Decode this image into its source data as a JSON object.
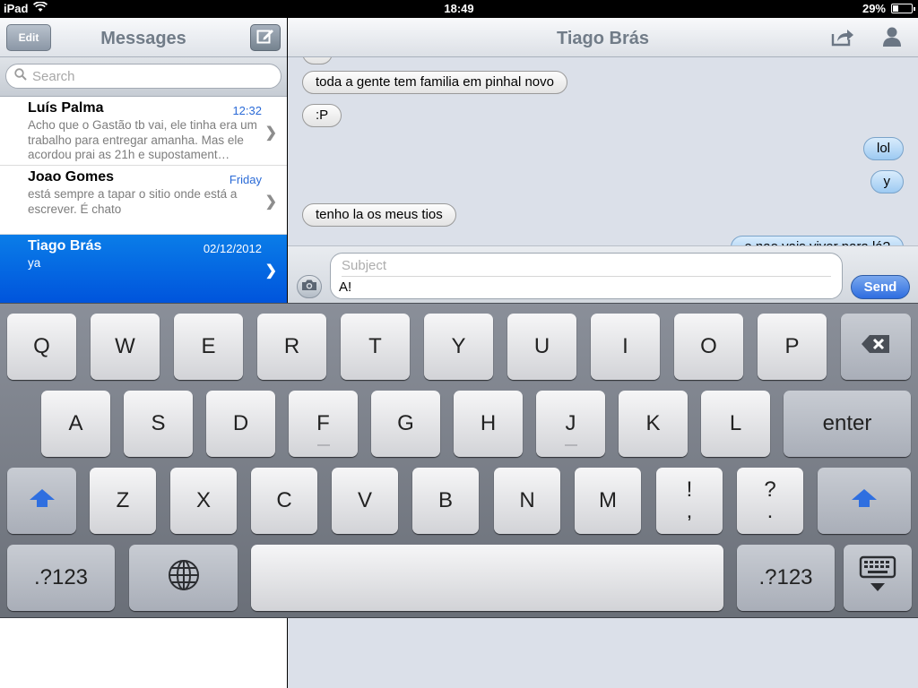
{
  "status_bar": {
    "device": "iPad",
    "time": "18:49",
    "battery": "29%",
    "battery_level": 0.29
  },
  "sidebar": {
    "title": "Messages",
    "edit_label": "Edit",
    "search_placeholder": "Search",
    "conversations": [
      {
        "name": "Luís Palma",
        "time": "12:32",
        "preview": "Acho que o Gastão tb vai, ele tinha era um trabalho para entregar amanha. Mas ele acordou prai as 21h e supostament…",
        "selected": false
      },
      {
        "name": "Joao Gomes",
        "time": "Friday",
        "preview": "está sempre a tapar o sitio onde está a escrever. É chato",
        "selected": false
      },
      {
        "name": "Tiago Brás",
        "time": "02/12/2012",
        "preview": "ya",
        "selected": true
      }
    ]
  },
  "conversation": {
    "title": "Tiago Brás",
    "messages": [
      {
        "text": "toda a gente tem familia em pinhal novo",
        "direction": "incoming"
      },
      {
        "text": ":P",
        "direction": "incoming"
      },
      {
        "text": "lol",
        "direction": "outgoing"
      },
      {
        "text": "y",
        "direction": "outgoing"
      },
      {
        "text": "tenho la os meus tios",
        "direction": "incoming"
      },
      {
        "text": "e nao vais viver para lá?",
        "direction": "outgoing"
      }
    ],
    "subject_placeholder": "Subject",
    "message_text": "A!",
    "send_label": "Send"
  },
  "keyboard": {
    "row1": [
      "Q",
      "W",
      "E",
      "R",
      "T",
      "Y",
      "U",
      "I",
      "O",
      "P"
    ],
    "row2": [
      "A",
      "S",
      "D",
      "F",
      "G",
      "H",
      "J",
      "K",
      "L"
    ],
    "enter_label": "enter",
    "row3": [
      "Z",
      "X",
      "C",
      "V",
      "B",
      "N",
      "M"
    ],
    "punct1": [
      "!",
      ","
    ],
    "punct2": [
      "?",
      "."
    ],
    "numbers_label": ".?123"
  },
  "colors": {
    "accent": "#0a7de8",
    "time_link": "#2b6bd7",
    "thread_bg": "#dbe0e9"
  }
}
